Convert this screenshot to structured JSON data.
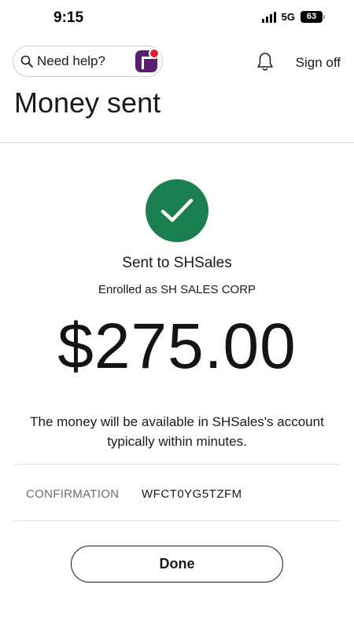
{
  "status_bar": {
    "time": "9:15",
    "network": "5G",
    "battery": "63"
  },
  "header": {
    "search_label": "Need help?",
    "sign_off_label": "Sign off"
  },
  "page_title": "Money sent",
  "confirmation_panel": {
    "recipient_line": "Sent to SHSales",
    "enrolled_line": "Enrolled as SH SALES CORP",
    "amount": "$275.00",
    "availability_message": "The money will be available in SHSales's account typically within minutes.",
    "confirmation_label": "CONFIRMATION",
    "confirmation_number": "WFCT0YG5TZFM"
  },
  "actions": {
    "done_label": "Done"
  },
  "colors": {
    "success_green": "#1b7f4f",
    "badge_purple": "#5a1e6e",
    "badge_red_dot": "#e0202d"
  },
  "icons": [
    "search-icon",
    "fargo-assistant-icon",
    "bell-icon",
    "checkmark-icon",
    "signal-icon",
    "battery-icon"
  ]
}
